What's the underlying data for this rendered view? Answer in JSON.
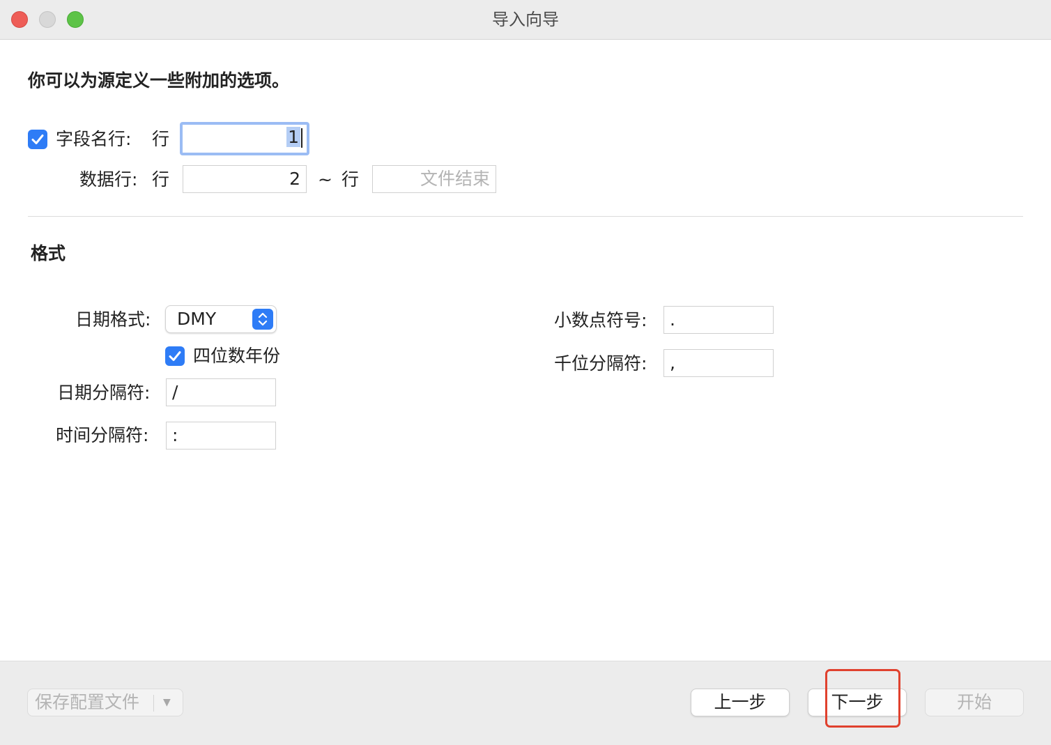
{
  "window": {
    "title": "导入向导"
  },
  "intro": "你可以为源定义一些附加的选项。",
  "field_row": {
    "checked": true,
    "label": "字段名行:",
    "unit": "行",
    "value": "1"
  },
  "data_row": {
    "label": "数据行:",
    "unit": "行",
    "from": "2",
    "tilde": "~",
    "unit2": "行",
    "to_placeholder": "文件结束"
  },
  "format": {
    "heading": "格式",
    "date_format_label": "日期格式:",
    "date_format_value": "DMY",
    "four_digit_year": {
      "checked": true,
      "label": "四位数年份"
    },
    "date_sep_label": "日期分隔符:",
    "date_sep_value": "/",
    "time_sep_label": "时间分隔符:",
    "time_sep_value": ":",
    "decimal_label": "小数点符号:",
    "decimal_value": ".",
    "thousand_label": "千位分隔符:",
    "thousand_value": ","
  },
  "footer": {
    "save_profile": "保存配置文件",
    "prev": "上一步",
    "next": "下一步",
    "start": "开始"
  },
  "colors": {
    "accent": "#2e7cf6",
    "highlight": "#e0412e"
  }
}
